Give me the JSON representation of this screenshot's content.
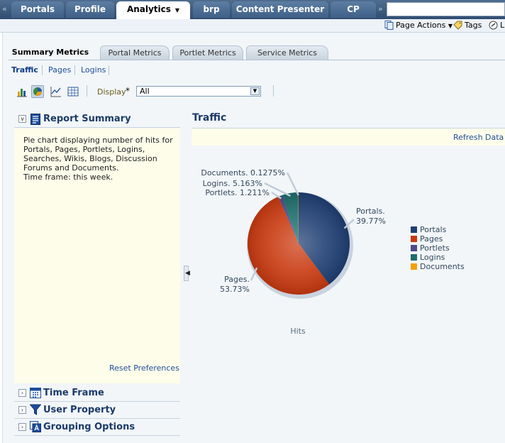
{
  "top_tabs": [
    {
      "label": "Portals",
      "active": false
    },
    {
      "label": "Profile",
      "active": false
    },
    {
      "label": "Analytics",
      "active": true
    },
    {
      "label": "brp",
      "active": false
    },
    {
      "label": "Content Presenter",
      "active": false
    },
    {
      "label": "CP",
      "active": false
    }
  ],
  "page_actions": {
    "page_actions_label": "Page Actions",
    "tags_label": "Tags",
    "third_label": "L"
  },
  "metric_tabs": [
    {
      "label": "Summary Metrics",
      "active": true
    },
    {
      "label": "Portal Metrics",
      "active": false
    },
    {
      "label": "Portlet Metrics",
      "active": false
    },
    {
      "label": "Service Metrics",
      "active": false
    }
  ],
  "sub_tabs": [
    {
      "label": "Traffic",
      "active": true
    },
    {
      "label": "Pages",
      "active": false
    },
    {
      "label": "Logins",
      "active": false
    }
  ],
  "toolbar": {
    "icons": [
      "bar-chart-icon",
      "pie-chart-icon",
      "line-chart-icon",
      "table-icon"
    ],
    "selected": "pie-chart-icon",
    "display_label": "Display",
    "required_mark": "*",
    "display_value": "All"
  },
  "left_panel": {
    "report_summary": {
      "title": "Report Summary",
      "description": "Pie chart displaying number of hits for Portals, Pages, Portlets, Logins, Searches, Wikis, Blogs, Discussion Forums and Documents.",
      "timeframe": "Time frame: this week.",
      "reset_label": "Reset Preferences"
    },
    "sections": [
      {
        "title": "Time Frame",
        "icon": "calendar-icon"
      },
      {
        "title": "User Property",
        "icon": "filter-icon"
      },
      {
        "title": "Grouping Options",
        "icon": "grouping-icon"
      }
    ]
  },
  "right_panel": {
    "title": "Traffic",
    "refresh_label": "Refresh Data"
  },
  "chart_data": {
    "type": "pie",
    "xlabel": "Hits",
    "categories": [
      "Portals",
      "Pages",
      "Portlets",
      "Logins",
      "Documents"
    ],
    "values": [
      39.77,
      53.73,
      1.211,
      5.163,
      0.1275
    ],
    "value_labels": [
      "39.77%",
      "53.73%",
      "1.211%",
      "5.163%",
      "0.1275%"
    ],
    "colors": [
      "#1f3f73",
      "#c93a10",
      "#4d4a8a",
      "#1d6e6c",
      "#f2a10c"
    ],
    "legend": "right"
  },
  "colors": {
    "link": "#1f4e9a",
    "header_text": "#1b3a67",
    "panel_bg": "#fdfdea",
    "top_bar": "#3f6087"
  }
}
